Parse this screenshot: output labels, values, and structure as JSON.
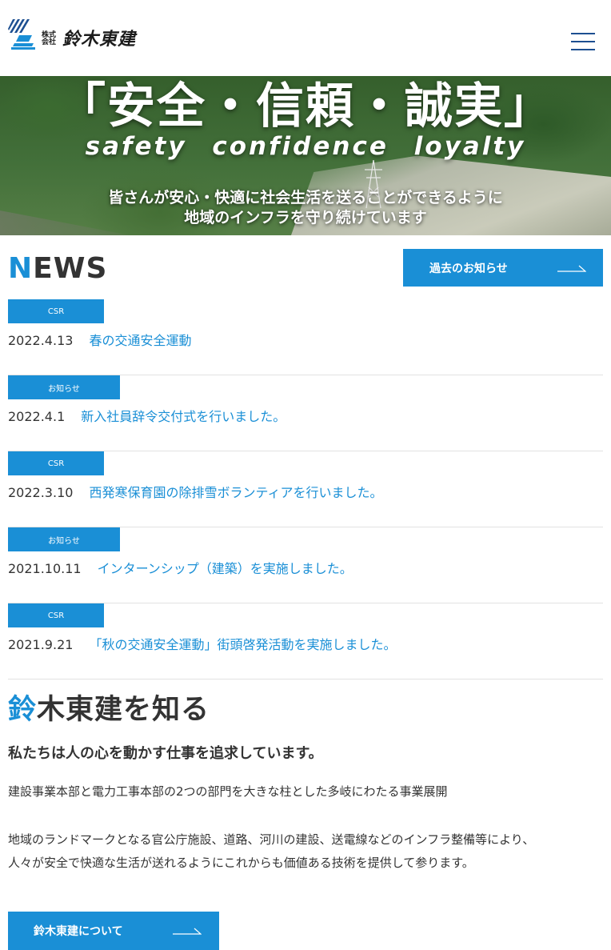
{
  "header": {
    "logo_kabushiki": "株式会社",
    "logo_name": "鈴木東建",
    "logo_mark_icon": "diagonal-stripes-logo-icon",
    "menu_icon": "hamburger-menu-icon"
  },
  "hero": {
    "title": "「安全・信頼・誠実」",
    "subtitle_en": "safety confidence loyalty",
    "lead_line1": "皆さんが安心・快適に社会生活を送ることができるように",
    "lead_line2": "地域のインフラを守り続けています"
  },
  "news": {
    "title_accent": "N",
    "title_rest": "EWS",
    "past_button_label": "過去のお知らせ",
    "items": [
      {
        "tag": "CSR",
        "date": "2022.4.13",
        "title": "春の交通安全運動"
      },
      {
        "tag": "お知らせ",
        "date": "2022.4.1",
        "title": "新入社員辞令交付式を行いました。"
      },
      {
        "tag": "CSR",
        "date": "2022.3.10",
        "title": "西発寒保育園の除排雪ボランティアを行いました。"
      },
      {
        "tag": "お知らせ",
        "date": "2021.10.11",
        "title": "インターンシップ（建築）を実施しました。"
      },
      {
        "tag": "CSR",
        "date": "2021.9.21",
        "title": "「秋の交通安全運動」街頭啓発活動を実施しました。"
      }
    ]
  },
  "about": {
    "title_accent": "鈴",
    "title_rest": "木東建を知る",
    "lead": "私たちは人の心を動かす仕事を追求しています。",
    "paragraph1": "建設事業本部と電力工事本部の2つの部門を大きな柱とした多岐にわたる事業展開",
    "paragraph2_line1": "地域のランドマークとなる官公庁施設、道路、河川の建設、送電線などのインフラ整備等により、",
    "paragraph2_line2": "人々が安全で快適な生活が送れるようにこれからも価値ある技術を提供して参ります。",
    "button_label": "鈴木東建について"
  },
  "colors": {
    "accent_blue": "#1a8fd6",
    "logo_navy": "#1d4f91",
    "text": "#333333"
  }
}
